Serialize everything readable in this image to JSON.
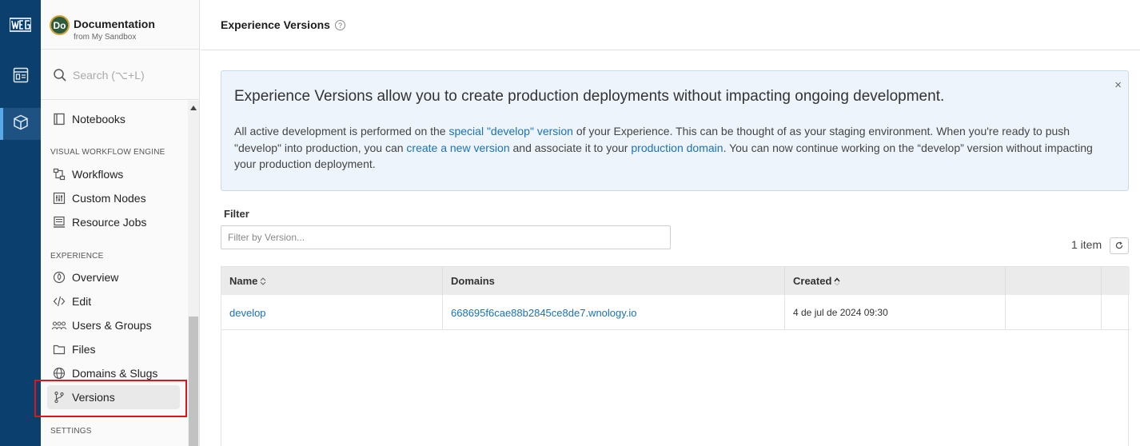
{
  "rail": {
    "logo_text": "WEG",
    "items": [
      "dashboard-icon",
      "cube-icon"
    ]
  },
  "app": {
    "avatar_initials": "Do",
    "title": "Documentation",
    "subtitle": "from My Sandbox"
  },
  "search": {
    "placeholder": "Search (⌥+L)"
  },
  "nav": {
    "notebooks": "Notebooks",
    "section_workflow": "VISUAL WORKFLOW ENGINE",
    "workflows": "Workflows",
    "custom_nodes": "Custom Nodes",
    "resource_jobs": "Resource Jobs",
    "section_experience": "EXPERIENCE",
    "overview": "Overview",
    "edit": "Edit",
    "users_groups": "Users & Groups",
    "files": "Files",
    "domains_slugs": "Domains & Slugs",
    "versions": "Versions",
    "section_settings": "SETTINGS"
  },
  "page": {
    "title": "Experience Versions",
    "help_icon": "?"
  },
  "info": {
    "title": "Experience Versions allow you to create production deployments without impacting ongoing development.",
    "close": "×",
    "t1": "All active development is performed on the ",
    "l1": "special \"develop\" version",
    "t2": " of your Experience. This can be thought of as your staging environment. When you're ready to push \"develop\" into production, you can ",
    "l2": "create a new version",
    "t3": " and associate it to your ",
    "l3": "production domain",
    "t4": ". You can now continue working on the “develop” version without impacting your production deployment."
  },
  "filter": {
    "label": "Filter",
    "placeholder": "Filter by Version...",
    "value": ""
  },
  "count": "1 item",
  "table": {
    "columns": [
      "Name",
      "Domains",
      "Created",
      "",
      ""
    ],
    "rows": [
      {
        "name": "develop",
        "domains": "668695f6cae88b2845ce8de7.wnology.io",
        "created": "4 de jul de 2024 09:30"
      }
    ]
  },
  "colors": {
    "rail_bg": "#0b3f6e",
    "link": "#1a72b8",
    "info_bg": "#eef4fb",
    "highlight": "#e0141a"
  }
}
